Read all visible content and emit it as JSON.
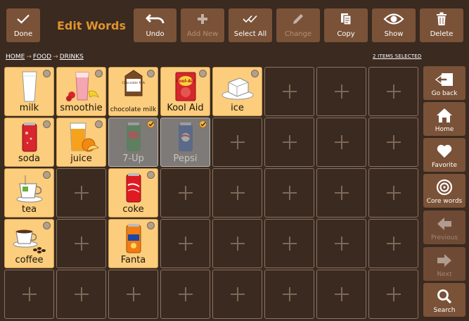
{
  "toolbar": {
    "done_label": "Done",
    "title": "Edit Words",
    "undo_label": "Undo",
    "add_new_label": "Add New",
    "select_all_label": "Select All",
    "change_label": "Change",
    "copy_label": "Copy",
    "show_label": "Show",
    "delete_label": "Delete"
  },
  "breadcrumb": {
    "home": "HOME",
    "food": "FOOD",
    "drinks": "DRINKS",
    "separator": "→"
  },
  "selection_count": "2 ITEMS SELECTED",
  "words": {
    "milk": "milk",
    "smoothie": "smoothie",
    "chocolate_milk": "chocolate milk",
    "kool_aid": "Kool Aid",
    "ice": "ice",
    "soda": "soda",
    "juice": "juice",
    "seven_up": "7-Up",
    "pepsi": "Pepsi",
    "tea": "tea",
    "coke": "coke",
    "coffee": "coffee",
    "fanta": "Fanta"
  },
  "picture_text": {
    "choc_box": "Chocolate Milk",
    "kool_aid_pack": "Kool-Aid"
  },
  "side": {
    "go_back": "Go back",
    "home": "Home",
    "favorite": "Favorite",
    "core_words": "Core words",
    "previous": "Previous",
    "next": "Next",
    "search": "Search"
  },
  "colors": {
    "background": "#3a2a20",
    "button": "#7a5238",
    "title": "#e0932e",
    "word_cell": "#fbcd7c",
    "selected_cell": "#7d7a77"
  }
}
